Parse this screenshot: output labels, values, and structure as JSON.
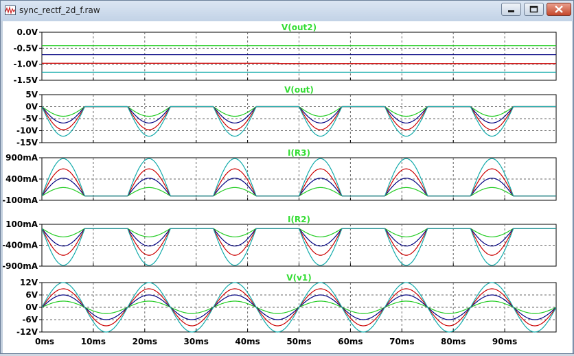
{
  "window": {
    "title": "sync_rectf_2d_f.raw",
    "app_icon": "waveform-icon",
    "controls": {
      "minimize_icon": "minimize-icon",
      "maximize_icon": "maximize-icon",
      "close_icon": "close-icon"
    }
  },
  "colors": {
    "trace_green": "#22cc22",
    "trace_blue": "#000080",
    "trace_red": "#cc0000",
    "trace_cyan": "#11aaaa",
    "title_green": "#33dd33",
    "label_text": "#000000",
    "grid": "#666666"
  },
  "x_axis": {
    "range": [
      0,
      100
    ],
    "unit": "ms",
    "tick_labels": [
      "0ms",
      "10ms",
      "20ms",
      "30ms",
      "40ms",
      "50ms",
      "60ms",
      "70ms",
      "80ms",
      "90ms"
    ]
  },
  "chart_data": [
    {
      "type": "line",
      "title": "V(out2)",
      "ylim": [
        -1.5,
        0
      ],
      "ytick_labels": [
        "0.0V",
        "-0.5V",
        "-1.0V",
        "-1.5V"
      ],
      "ytick_values": [
        0,
        -0.5,
        -1.0,
        -1.5
      ],
      "grid": true,
      "series": [
        {
          "color": "#22cc22",
          "levels": [
            -0.42
          ]
        },
        {
          "color": "#000080",
          "levels": [
            -0.7
          ]
        },
        {
          "color": "#cc0000",
          "levels": [
            -0.97,
            -0.98
          ]
        },
        {
          "color": "#11aaaa",
          "levels": [
            -1.25
          ]
        }
      ]
    },
    {
      "type": "line",
      "title": "V(out)",
      "ylim": [
        -15,
        5
      ],
      "ytick_labels": [
        "5V",
        "0V",
        "-5V",
        "-10V",
        "-15V"
      ],
      "ytick_values": [
        5,
        0,
        -5,
        -10,
        -15
      ],
      "grid": true,
      "waveform": "negative-half-rectified-sine",
      "period_ms": 16.67,
      "series": [
        {
          "color": "#22cc22",
          "peak": -4
        },
        {
          "color": "#000080",
          "peak": -6.8
        },
        {
          "color": "#cc0000",
          "peak": -9.6
        },
        {
          "color": "#11aaaa",
          "peak": -12.3
        }
      ]
    },
    {
      "type": "line",
      "title": "I(R3)",
      "ylim": [
        -100,
        900
      ],
      "ytick_labels": [
        "900mA",
        "400mA",
        "-100mA"
      ],
      "ytick_values": [
        900,
        400,
        -100
      ],
      "grid": true,
      "waveform": "positive-half-rectified-sine",
      "period_ms": 16.67,
      "series": [
        {
          "color": "#22cc22",
          "peak": 200
        },
        {
          "color": "#000080",
          "peak": 420
        },
        {
          "color": "#cc0000",
          "peak": 640
        },
        {
          "color": "#11aaaa",
          "peak": 880
        }
      ]
    },
    {
      "type": "line",
      "title": "I(R2)",
      "ylim": [
        -900,
        100
      ],
      "ytick_labels": [
        "100mA",
        "-400mA",
        "-900mA"
      ],
      "ytick_values": [
        100,
        -400,
        -900
      ],
      "grid": true,
      "waveform": "negative-half-rectified-sine",
      "period_ms": 16.67,
      "series": [
        {
          "color": "#22cc22",
          "peak": -200
        },
        {
          "color": "#000080",
          "peak": -420
        },
        {
          "color": "#cc0000",
          "peak": -640
        },
        {
          "color": "#11aaaa",
          "peak": -880
        }
      ]
    },
    {
      "type": "line",
      "title": "V(v1)",
      "ylim": [
        -12,
        12
      ],
      "ytick_labels": [
        "12V",
        "6V",
        "0V",
        "-6V",
        "-12V"
      ],
      "ytick_values": [
        12,
        6,
        0,
        -6,
        -12
      ],
      "grid": true,
      "waveform": "sine",
      "period_ms": 16.67,
      "series": [
        {
          "color": "#22cc22",
          "peak": 3
        },
        {
          "color": "#000080",
          "peak": 6
        },
        {
          "color": "#cc0000",
          "peak": 9
        },
        {
          "color": "#11aaaa",
          "peak": 12
        }
      ]
    }
  ]
}
